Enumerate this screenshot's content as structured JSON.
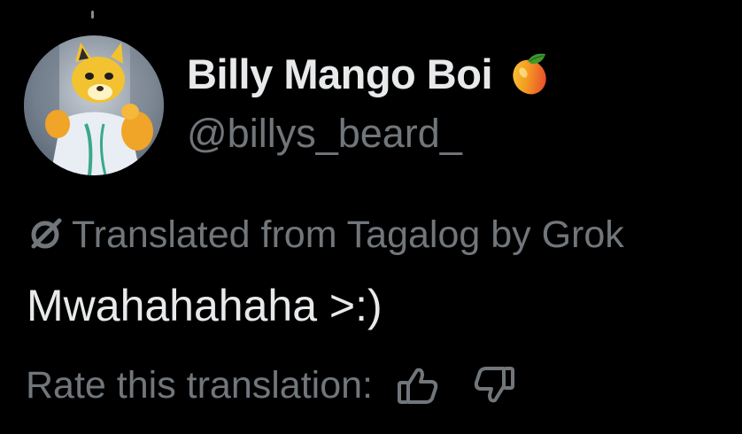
{
  "user": {
    "display_name": "Billy Mango Boi",
    "handle": "@billys_beard_",
    "name_emoji_icon": "mango-icon"
  },
  "translation": {
    "notice": "Translated from Tagalog by Grok",
    "icon": "slashed-circle-icon"
  },
  "post": {
    "text": "Mwahahahaha >:)"
  },
  "rating": {
    "label": "Rate this translation:",
    "thumbs_up_icon": "thumbs-up-icon",
    "thumbs_down_icon": "thumbs-down-icon"
  },
  "colors": {
    "background": "#000000",
    "primary_text": "#e7e9ea",
    "secondary_text": "#71767b"
  }
}
